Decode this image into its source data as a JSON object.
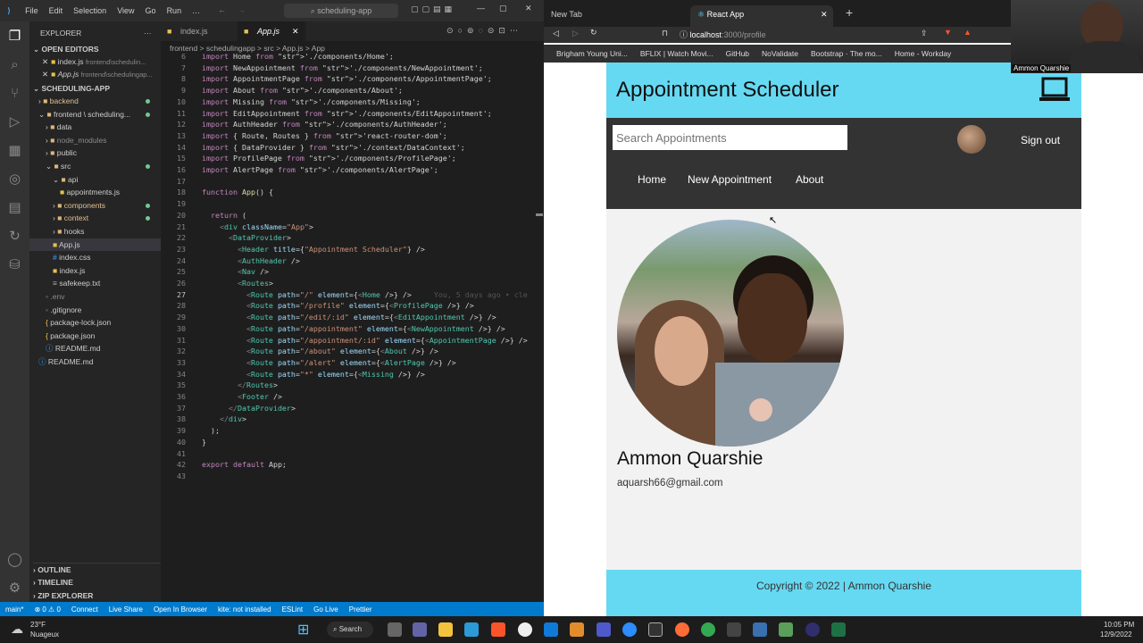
{
  "vscode": {
    "menu": [
      "File",
      "Edit",
      "Selection",
      "View",
      "Go",
      "Run",
      "…"
    ],
    "search": "scheduling-app",
    "explorer_title": "EXPLORER",
    "open_editors_title": "OPEN EDITORS",
    "open_editors": [
      {
        "name": "index.js",
        "path": "frontend\\schedulin..."
      },
      {
        "name": "App.js",
        "path": "frontend\\schedulingap..."
      }
    ],
    "project_title": "SCHEDULING-APP",
    "tree": [
      {
        "name": "backend",
        "indent": 1,
        "type": "folder"
      },
      {
        "name": "frontend \\ scheduling...",
        "indent": 1,
        "type": "folder-open"
      },
      {
        "name": "data",
        "indent": 2,
        "type": "folder"
      },
      {
        "name": "node_modules",
        "indent": 2,
        "type": "folder"
      },
      {
        "name": "public",
        "indent": 2,
        "type": "folder"
      },
      {
        "name": "src",
        "indent": 2,
        "type": "folder-open"
      },
      {
        "name": "api",
        "indent": 3,
        "type": "folder-open"
      },
      {
        "name": "appointments.js",
        "indent": 4,
        "type": "js"
      },
      {
        "name": "components",
        "indent": 3,
        "type": "folder"
      },
      {
        "name": "context",
        "indent": 3,
        "type": "folder"
      },
      {
        "name": "hooks",
        "indent": 3,
        "type": "folder"
      },
      {
        "name": "App.js",
        "indent": 3,
        "type": "js"
      },
      {
        "name": "index.css",
        "indent": 3,
        "type": "css"
      },
      {
        "name": "index.js",
        "indent": 3,
        "type": "js"
      },
      {
        "name": "safekeep.txt",
        "indent": 3,
        "type": "txt"
      },
      {
        "name": ".env",
        "indent": 2,
        "type": "file"
      },
      {
        "name": ".gitignore",
        "indent": 2,
        "type": "file"
      },
      {
        "name": "package-lock.json",
        "indent": 2,
        "type": "json"
      },
      {
        "name": "package.json",
        "indent": 2,
        "type": "json"
      },
      {
        "name": "README.md",
        "indent": 2,
        "type": "md"
      },
      {
        "name": "README.md",
        "indent": 1,
        "type": "md"
      }
    ],
    "outline": "OUTLINE",
    "timeline": "TIMELINE",
    "zip": "ZIP EXPLORER",
    "tabs": [
      "index.js",
      "App.js"
    ],
    "breadcrumb": "frontend > schedulingapp > src > App.js > App",
    "code_lines": [
      {
        "n": "6",
        "t": "import Home from './components/Home';"
      },
      {
        "n": "7",
        "t": "import NewAppointment from './components/NewAppointment';"
      },
      {
        "n": "8",
        "t": "import AppointmentPage from './components/AppointmentPage';"
      },
      {
        "n": "9",
        "t": "import About from './components/About';"
      },
      {
        "n": "10",
        "t": "import Missing from './components/Missing';"
      },
      {
        "n": "11",
        "t": "import EditAppointment from './components/EditAppointment';"
      },
      {
        "n": "12",
        "t": "import AuthHeader from './components/AuthHeader';"
      },
      {
        "n": "13",
        "t": "import { Route, Routes } from 'react-router-dom';"
      },
      {
        "n": "14",
        "t": "import { DataProvider } from './context/DataContext';"
      },
      {
        "n": "15",
        "t": "import ProfilePage from './components/ProfilePage';"
      },
      {
        "n": "16",
        "t": "import AlertPage from './components/AlertPage';"
      },
      {
        "n": "17",
        "t": ""
      },
      {
        "n": "18",
        "t": "function App() {"
      },
      {
        "n": "19",
        "t": ""
      },
      {
        "n": "20",
        "t": "  return ("
      },
      {
        "n": "21",
        "t": "    <div className=\"App\">"
      },
      {
        "n": "22",
        "t": "      <DataProvider>"
      },
      {
        "n": "23",
        "t": "        <Header title={\"Appointment Scheduler\"} />"
      },
      {
        "n": "24",
        "t": "        <AuthHeader />"
      },
      {
        "n": "25",
        "t": "        <Nav />"
      },
      {
        "n": "26",
        "t": "        <Routes>"
      },
      {
        "n": "27",
        "t": "          <Route path=\"/\" element={<Home />} />     You, 5 days ago • cle"
      },
      {
        "n": "28",
        "t": "          <Route path=\"/profile\" element={<ProfilePage />} />"
      },
      {
        "n": "29",
        "t": "          <Route path=\"/edit/:id\" element={<EditAppointment />} />"
      },
      {
        "n": "30",
        "t": "          <Route path=\"/appointment\" element={<NewAppointment />} />"
      },
      {
        "n": "31",
        "t": "          <Route path=\"/appointment/:id\" element={<AppointmentPage />} />"
      },
      {
        "n": "32",
        "t": "          <Route path=\"/about\" element={<About />} />"
      },
      {
        "n": "33",
        "t": "          <Route path=\"/alert\" element={<AlertPage />} />"
      },
      {
        "n": "34",
        "t": "          <Route path=\"*\" element={<Missing />} />"
      },
      {
        "n": "35",
        "t": "        </Routes>"
      },
      {
        "n": "36",
        "t": "        <Footer />"
      },
      {
        "n": "37",
        "t": "      </DataProvider>"
      },
      {
        "n": "38",
        "t": "    </div>"
      },
      {
        "n": "39",
        "t": "  );"
      },
      {
        "n": "40",
        "t": "}"
      },
      {
        "n": "41",
        "t": ""
      },
      {
        "n": "42",
        "t": "export default App;"
      },
      {
        "n": "43",
        "t": ""
      }
    ],
    "status": [
      "main*",
      "⊗ 0 ⚠ 0",
      "Connect",
      "Live Share",
      "Open In Browser",
      "kite: not installed",
      "ESLint",
      "Go Live",
      "Prettier"
    ]
  },
  "browser": {
    "tabs": [
      "New Tab",
      "React App"
    ],
    "url_host": "localhost",
    "url_rest": ":3000/profile",
    "bookmarks": [
      "Brigham Young Uni...",
      "BFLIX | Watch Movi...",
      "GitHub",
      "NoValidate",
      "Bootstrap · The mo...",
      "Home - Workday"
    ]
  },
  "app": {
    "title": "Appointment Scheduler",
    "search_placeholder": "Search Appointments",
    "signout": "Sign out",
    "nav": [
      "Home",
      "New Appointment",
      "About"
    ],
    "profile_name": "Ammon Quarshie",
    "profile_email": "aquarsh66@gmail.com",
    "footer": "Copyright © 2022 | Ammon Quarshie"
  },
  "webcam": {
    "name": "Ammon Quarshie"
  },
  "taskbar": {
    "weather_temp": "23°F",
    "weather_desc": "Nuageux",
    "search": "Search",
    "time": "10:05 PM",
    "date": "12/9/2022"
  }
}
